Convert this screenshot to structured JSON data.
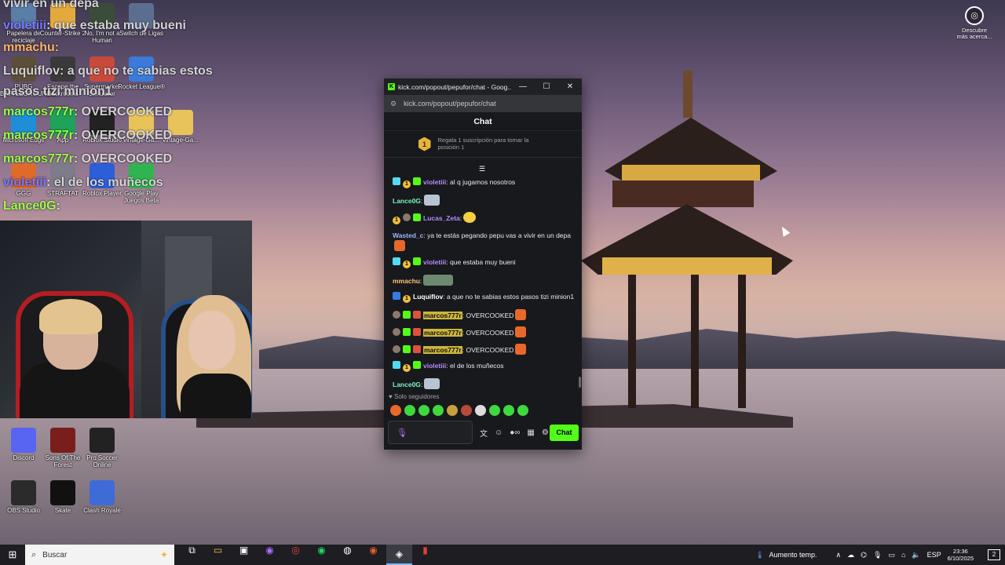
{
  "desktop": {
    "icons": [
      {
        "label": "Papelera de reciclaje",
        "icon": "recycle-bin-icon",
        "color": "#5b7ea8"
      },
      {
        "label": "Counter-Strike 2",
        "icon": "cs2-icon",
        "color": "#e4a93c"
      },
      {
        "label": "No, I'm not a Human",
        "icon": "game-icon",
        "color": "#3b4d3a"
      },
      {
        "label": "Switch de Ligas",
        "icon": "game-icon",
        "color": "#5c6e8f"
      },
      {
        "label": "PUBG BATTLEGROUNDS",
        "icon": "pubg-icon",
        "color": "#5c4f3a"
      },
      {
        "label": "Escape the Backrooms",
        "icon": "game-icon",
        "color": "#3a3a3a"
      },
      {
        "label": "Supermarket Simulator",
        "icon": "game-icon",
        "color": "#c84a3a"
      },
      {
        "label": "Rocket League®",
        "icon": "rocket-league-icon",
        "color": "#3b7ad8"
      },
      {
        "label": "Microsoft Edge",
        "icon": "edge-icon",
        "color": "#1e8ed6"
      },
      {
        "label": "App",
        "icon": "app-icon",
        "color": "#1fa35a"
      },
      {
        "label": "Roblox Studio",
        "icon": "roblox-studio-icon",
        "color": "#222222"
      },
      {
        "label": "vintage-Ga...",
        "icon": "folder-icon",
        "color": "#e8c35a"
      },
      {
        "label": "vintage-Ga...",
        "icon": "folder-icon",
        "color": "#e8c35a"
      },
      {
        "label": "GGG",
        "icon": "app-icon",
        "color": "#e06a2c"
      },
      {
        "label": "STRAFTAT",
        "icon": "game-icon",
        "color": "#7c7c8a"
      },
      {
        "label": "Roblox Player",
        "icon": "roblox-icon",
        "color": "#2c5ed8"
      },
      {
        "label": "Google Play Juegos Beta",
        "icon": "google-play-icon",
        "color": "#2fb44f"
      },
      {
        "label": "Discord",
        "icon": "discord-icon",
        "color": "#5865f2"
      },
      {
        "label": "Sons Of The Forest",
        "icon": "game-icon",
        "color": "#7a1d1d"
      },
      {
        "label": "Pro Soccer Online",
        "icon": "soccer-icon",
        "color": "#222222"
      },
      {
        "label": "OBS Studio",
        "icon": "obs-icon",
        "color": "#2b2b2b"
      },
      {
        "label": "Skate",
        "icon": "skate-icon",
        "color": "#111111"
      },
      {
        "label": "Clash Royale",
        "icon": "clash-royale-icon",
        "color": "#3f6bd6"
      }
    ],
    "discover": "Descubre más acerca..."
  },
  "overlay": {
    "lines": [
      {
        "text": "vivir en un depa",
        "cls": ""
      },
      {
        "user": "violetiii",
        "text": ": que estaba muy bueni",
        "cls": "ov-user-v"
      },
      {
        "user": "mmachu:",
        "text": "",
        "cls": "ov-user-o"
      },
      {
        "user": "Luquiflov",
        "text": ": a que no te sabias estos",
        "cls": "ov-user-w"
      },
      {
        "text": "pasos tizi minion1",
        "cls": ""
      },
      {
        "user": "marcos777r",
        "text": ": OVERCOOKED",
        "cls": "ov-user-g"
      },
      {
        "user": "marcos777r",
        "text": ": OVERCOOKED",
        "cls": "ov-user-g"
      },
      {
        "user": "marcos777r",
        "text": ": OVERCOOKED",
        "cls": "ov-user-g"
      },
      {
        "user": "violetiii",
        "text": ": el de los muñecos",
        "cls": "ov-user-v"
      },
      {
        "user": "Lance0G",
        "text": ":",
        "cls": "ov-user-g"
      }
    ]
  },
  "window": {
    "title": "kick.com/popout/pepufor/chat - Goog...",
    "address": "kick.com/popout/pepufor/chat",
    "header": "Chat",
    "pinned": {
      "rank": "1",
      "text": "Regala 1 suscripción para tomar la posición 1"
    },
    "followers_only": "Solo seguidores",
    "send_label": "Chat",
    "messages": [
      {
        "badges": [
          "b-sub",
          "b-gift",
          "b-og"
        ],
        "user": "violetiii",
        "ucls": "u-violet",
        "text": ": al q jugamos nosotros",
        "emote": ""
      },
      {
        "badges": [],
        "user": "Lance0G",
        "ucls": "u-lance",
        "text": ":",
        "emote": "e-ghost"
      },
      {
        "badges": [
          "b-gift",
          "b-mod",
          "b-og"
        ],
        "user": "Lucas_Zeta",
        "ucls": "u-lucas",
        "text": ":",
        "emote": "e-face"
      },
      {
        "badges": [],
        "user": "Wasted_c",
        "ucls": "u-wasted",
        "text": ": ya te estás pegando pepu vas a vivir en un depa",
        "emote": "e-orange"
      },
      {
        "badges": [
          "b-sub",
          "b-gift",
          "b-og"
        ],
        "user": "violetiii",
        "ucls": "u-violet",
        "text": ": que estaba muy bueni",
        "emote": ""
      },
      {
        "badges": [],
        "user": "mmachu",
        "ucls": "u-mmachu",
        "text": ":",
        "emote": "e-img"
      },
      {
        "badges": [
          "b-boost",
          "b-gift"
        ],
        "user": "Luquiflov",
        "ucls": "u-luqui",
        "text": ": a que no te sabias estos pasos tizi minion1",
        "emote": ""
      },
      {
        "badges": [
          "b-mod",
          "b-og",
          "b-vip"
        ],
        "user": "marcos777r",
        "ucls": "u-marcos",
        "text": ": OVERCOOKED",
        "emote": "e-orange"
      },
      {
        "badges": [
          "b-mod",
          "b-og",
          "b-vip"
        ],
        "user": "marcos777r",
        "ucls": "u-marcos",
        "text": ": OVERCOOKED",
        "emote": "e-orange"
      },
      {
        "badges": [
          "b-mod",
          "b-og",
          "b-vip"
        ],
        "user": "marcos777r",
        "ucls": "u-marcos",
        "text": ": OVERCOOKED",
        "emote": "e-orange"
      },
      {
        "badges": [
          "b-sub",
          "b-gift",
          "b-og"
        ],
        "user": "violetiii",
        "ucls": "u-violet",
        "text": ": el de los muñecos",
        "emote": ""
      },
      {
        "badges": [],
        "user": "Lance0G",
        "ucls": "u-lance",
        "text": ":",
        "emote": "e-ghost"
      }
    ]
  },
  "taskbar": {
    "search_placeholder": "Buscar",
    "weather": "Aumento temp.",
    "lang": "ESP",
    "time": "23:36",
    "date": "6/10/2025",
    "notif_count": "2"
  }
}
